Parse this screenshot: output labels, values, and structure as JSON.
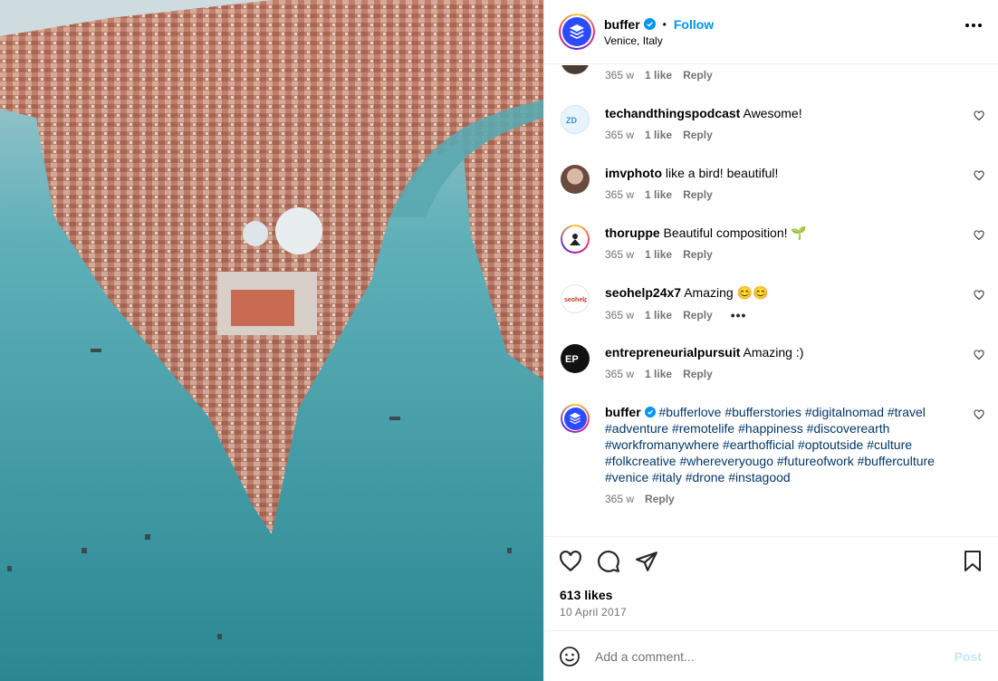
{
  "post": {
    "username": "buffer",
    "follow_label": "Follow",
    "location": "Venice, Italy",
    "more_icon": "more-horizontal-icon"
  },
  "comments": [
    {
      "user": "",
      "text": "",
      "age": "365 w",
      "likes": "1 like",
      "reply": "Reply"
    },
    {
      "user": "techandthingspodcast",
      "text": "Awesome!",
      "age": "365 w",
      "likes": "1 like",
      "reply": "Reply"
    },
    {
      "user": "imvphoto",
      "text": "like a bird! beautiful!",
      "age": "365 w",
      "likes": "1 like",
      "reply": "Reply"
    },
    {
      "user": "thoruppe",
      "text": "Beautiful composition! 🌱",
      "age": "365 w",
      "likes": "1 like",
      "reply": "Reply"
    },
    {
      "user": "seohelp24x7",
      "text": "Amazing 😊😊",
      "age": "365 w",
      "likes": "1 like",
      "reply": "Reply",
      "more": "•••"
    },
    {
      "user": "entrepreneurialpursuit",
      "text": "Amazing :)",
      "age": "365 w",
      "likes": "1 like",
      "reply": "Reply"
    }
  ],
  "caption": {
    "user": "buffer",
    "hashtags_line1": "#bufferlove #bufferstories #digitalnomad #travel",
    "hashtags_line2": "#adventure #remotelife #happiness #discoverearth",
    "hashtags_line3": "#workfromanywhere #earthofficial #optoutside #culture",
    "hashtags_line4": "#folkcreative #whereveryougo #futureofwork #bufferculture",
    "hashtags_line5": "#venice #italy #drone #instagood",
    "age": "365 w",
    "reply": "Reply"
  },
  "engagement": {
    "likes": "613 likes",
    "date": "10 April 2017"
  },
  "composer": {
    "placeholder": "Add a comment...",
    "post_label": "Post"
  },
  "colors": {
    "accent": "#0095f6",
    "hashtag": "#00376b",
    "buffer_blue": "#2c4bff",
    "post_disabled": "#c7e4fb"
  }
}
